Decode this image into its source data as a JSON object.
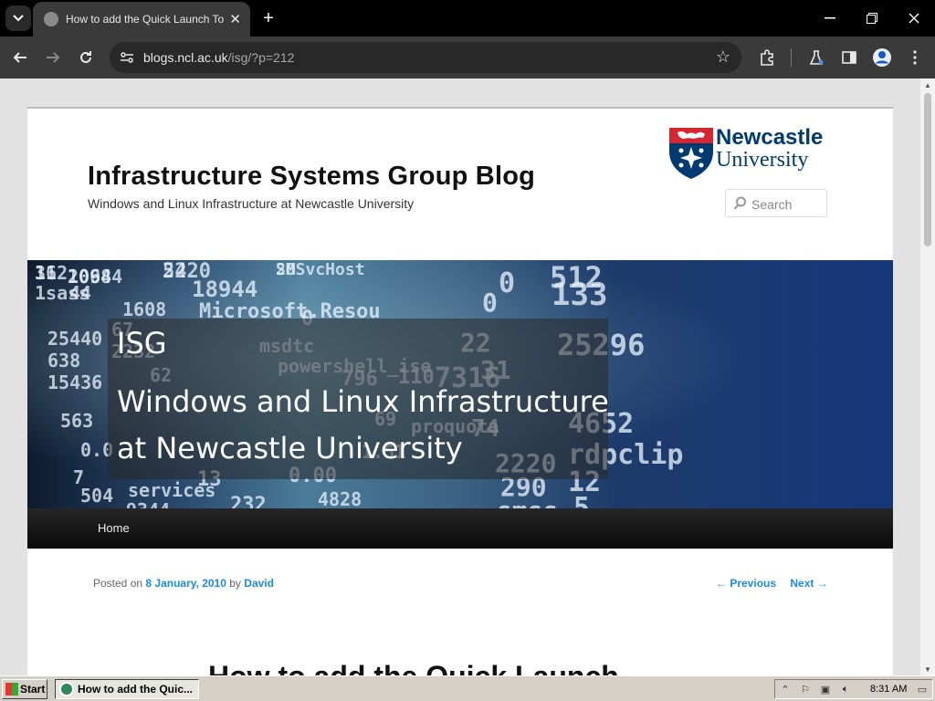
{
  "browser": {
    "tab_title": "How to add the Quick Launch Toolbar",
    "url_host": "blogs.ncl.ac.uk",
    "url_path": "/isg/?p=212"
  },
  "site": {
    "title": "Infrastructure Systems Group Blog",
    "description": "Windows and Linux Infrastructure at Newcastle University",
    "logo_line1": "Newcastle",
    "logo_line2": "University",
    "search_placeholder": "Search"
  },
  "banner": {
    "line1": "ISG",
    "line2": "Windows and Linux Infrastructure",
    "line3": "at Newcastle University",
    "bg_text": [
      "16",
      "20944",
      "54",
      "20",
      "0",
      "512",
      "1sass",
      "44",
      "18944",
      "0",
      "133",
      "1608",
      "Microsoft.Resou",
      "0",
      "25440",
      "67",
      "msdtc",
      "22",
      "25296",
      "638",
      "2232",
      "powershell_ise",
      "31",
      "15436",
      "62",
      "796",
      "110",
      "7316",
      "563",
      "69",
      "proquota",
      "74",
      "4652",
      "0.0",
      "1.51",
      "2220",
      "rdpclip",
      "7",
      "0.00",
      "504",
      "services",
      "13",
      "290",
      "12",
      "4828",
      "9344",
      "232",
      "smss",
      "5",
      "312",
      "1068",
      "2220",
      "SMSvcHost"
    ]
  },
  "menu": {
    "home": "Home"
  },
  "post": {
    "posted_on": "Posted on",
    "date": "8 January, 2010",
    "by": "by",
    "author": "David",
    "previous": "← Previous",
    "next": "Next →",
    "title": "How to add the Quick Launch"
  },
  "taskbar": {
    "start": "Start",
    "task_label": "How to add the Quic...",
    "clock": "8:31 AM"
  }
}
